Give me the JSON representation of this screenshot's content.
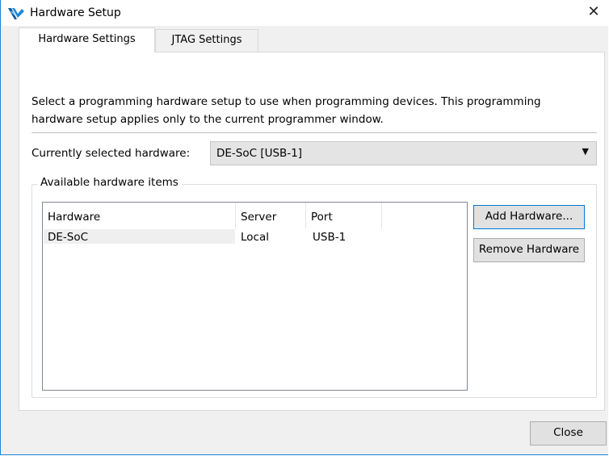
{
  "window": {
    "title": "Hardware Setup",
    "close_glyph": "✕"
  },
  "tabs": [
    {
      "label": "Hardware Settings",
      "active": true
    },
    {
      "label": "JTAG Settings",
      "active": false
    }
  ],
  "description": "Select a programming hardware setup to use when programming devices. This programming hardware setup applies only to the current programmer window.",
  "selected_hardware": {
    "label": "Currently selected hardware:",
    "value": "DE-SoC [USB-1]"
  },
  "available": {
    "group_title": "Available hardware items",
    "columns": [
      "Hardware",
      "Server",
      "Port"
    ],
    "rows": [
      {
        "hardware": "DE-SoC",
        "server": "Local",
        "port": "USB-1"
      }
    ]
  },
  "buttons": {
    "add": "Add Hardware...",
    "remove": "Remove Hardware",
    "close": "Close"
  },
  "icons": {
    "app": "intel-quartus-icon",
    "dropdown": "chevron-down-icon"
  }
}
